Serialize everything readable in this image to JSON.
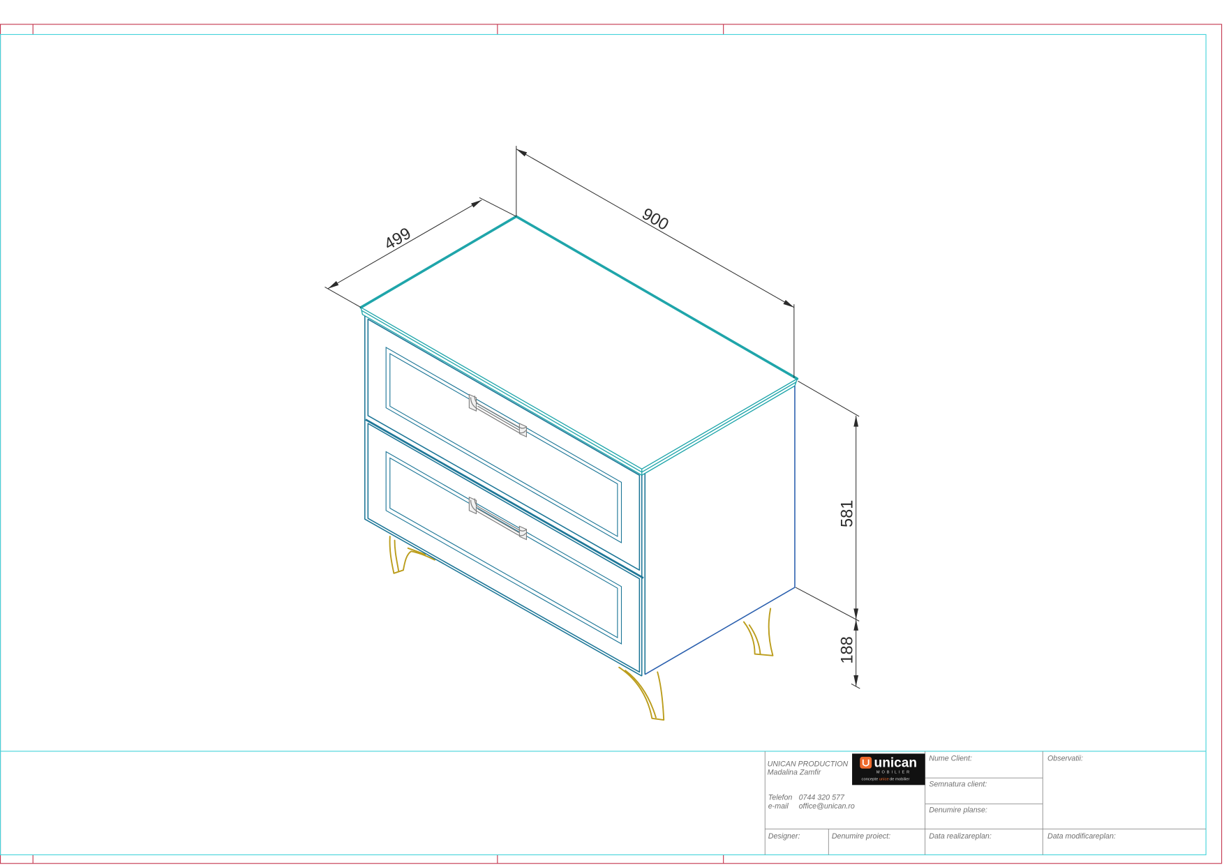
{
  "drawing": {
    "dimensions": {
      "width": "900",
      "depth": "499",
      "body_height": "581",
      "leg_height": "188"
    }
  },
  "logo": {
    "name": "unican",
    "subtitle": "MOBILIER",
    "tagline_pre": "concepte ",
    "tagline_accent": "unice",
    "tagline_post": "de mobilier",
    "icon": "unican-logo-icon"
  },
  "title_block": {
    "company": "UNICAN PRODUCTION",
    "person": "Madalina Zamfir",
    "phone_label": "Telefon",
    "phone": "0744 320 577",
    "email_label": "e-mail",
    "email": "office@unican.ro",
    "client_name_label": "Nume Client:",
    "client_signature_label": "Semnatura client:",
    "sheet_name_label": "Denumire planse:",
    "observations_label": "Observatii:",
    "designer_label": "Designer:",
    "project_name_label": "Denumire proiect:",
    "plan_date_label": "Data realizareplan:",
    "plan_modified_label": "Data modificareplan:"
  },
  "colors": {
    "frame_red": "#c4364e",
    "frame_cyan": "#45d3da",
    "cabinet": "#1d7697",
    "cabinet_top": "#1fa5aa",
    "cabinet_side": "#2a5fae",
    "legs": "#bb9d1c",
    "handles": "#7d7d7d",
    "dimensions": "#2b2b2b",
    "logo_accent": "#ef6a2c"
  }
}
